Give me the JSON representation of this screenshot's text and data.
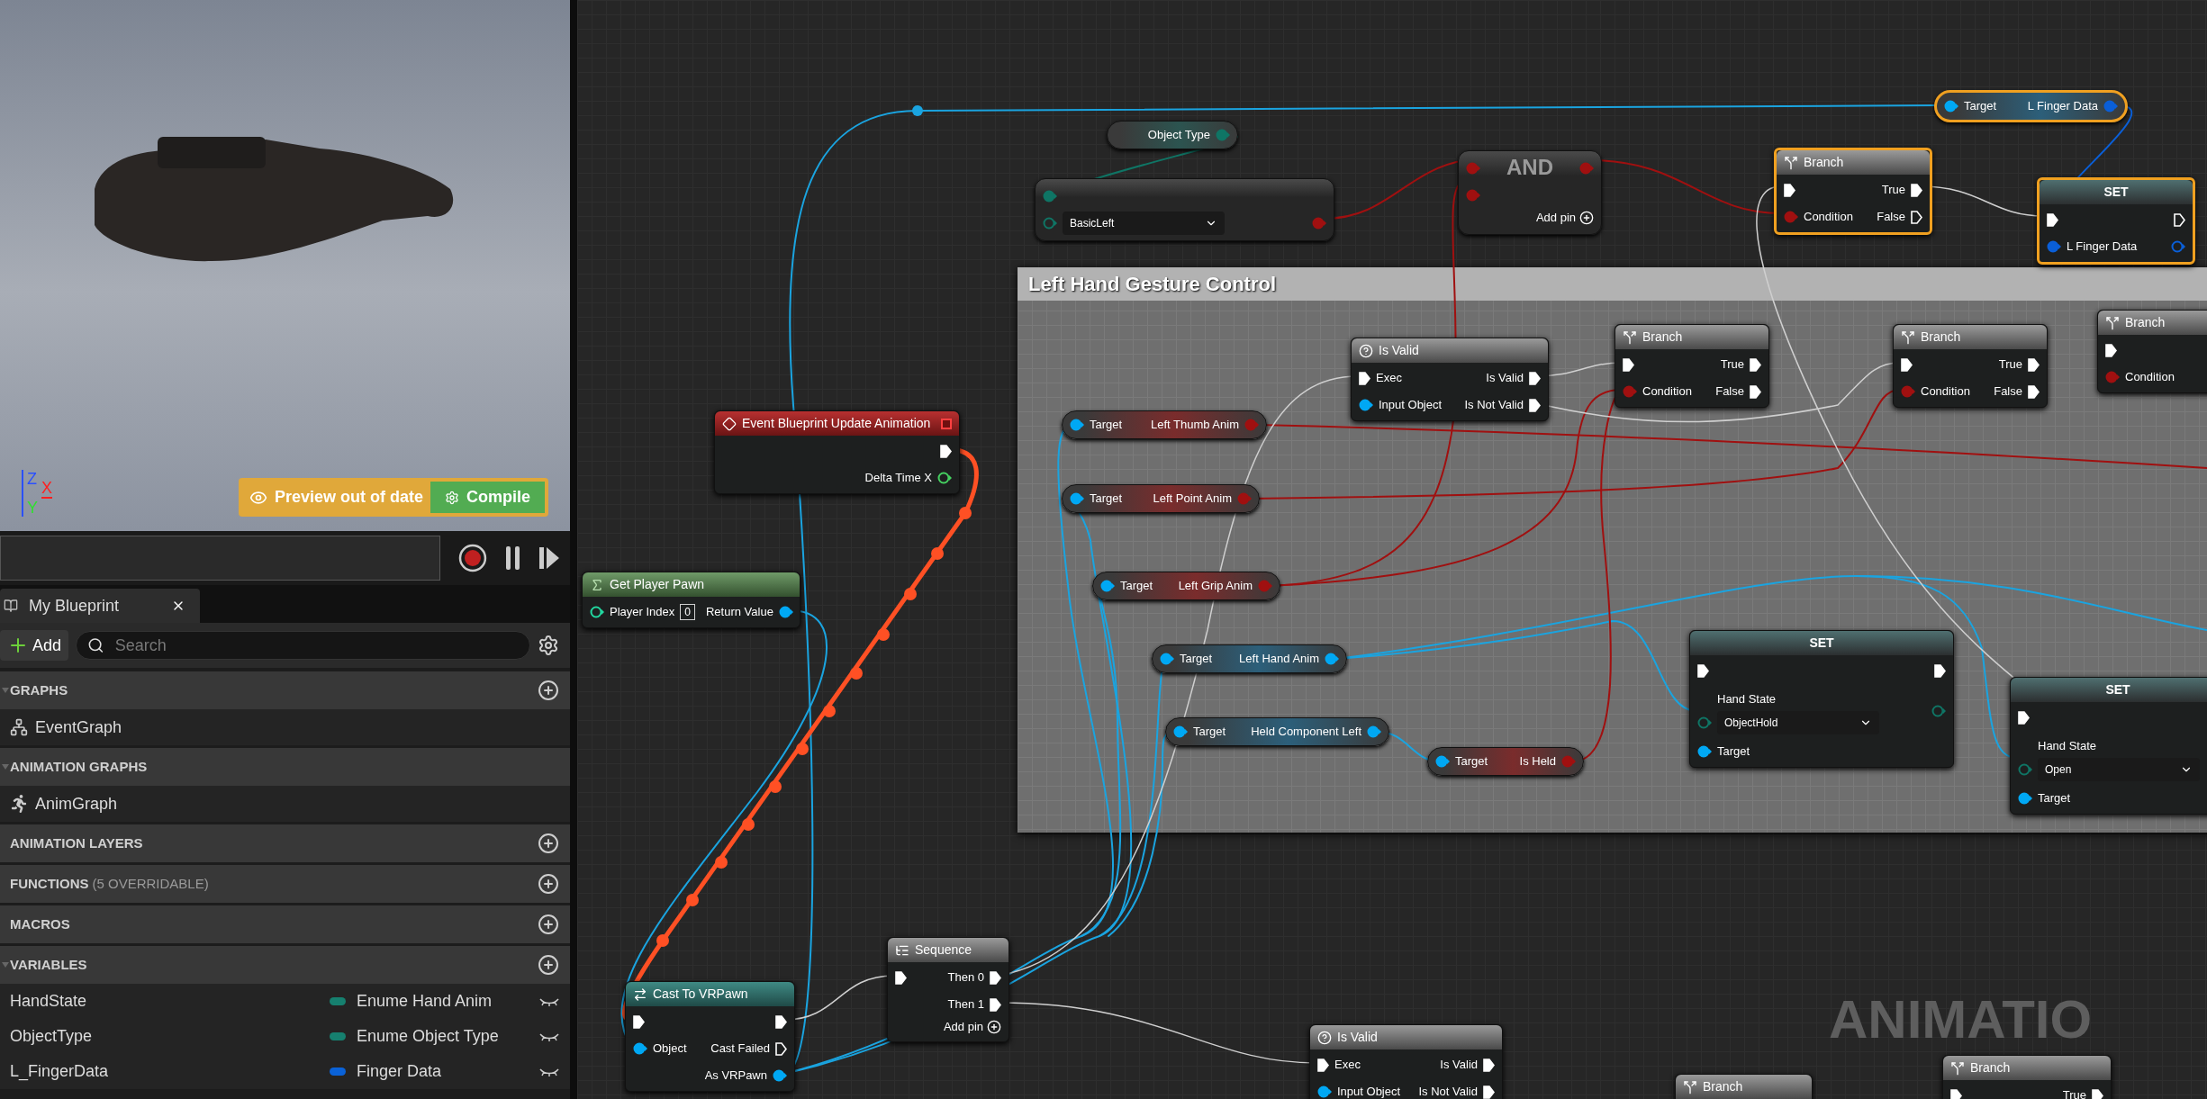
{
  "viewport": {
    "axes": [
      "Z",
      "Y",
      "X"
    ],
    "notice": "Preview out of date",
    "compile_button": "Compile"
  },
  "panel_tab": {
    "title": "My Blueprint"
  },
  "add_button": "Add",
  "search": {
    "placeholder": "Search"
  },
  "sections": [
    {
      "title": "GRAPHS",
      "expanded": true,
      "addable": true,
      "items": [
        {
          "name": "EventGraph",
          "kind": "graph"
        }
      ]
    },
    {
      "title": "ANIMATION GRAPHS",
      "expanded": true,
      "addable": false,
      "items": [
        {
          "name": "AnimGraph",
          "kind": "anim"
        }
      ]
    },
    {
      "title": "ANIMATION LAYERS",
      "expanded": false,
      "addable": true
    },
    {
      "title": "FUNCTIONS",
      "note": "(5 OVERRIDABLE)",
      "expanded": false,
      "addable": true
    },
    {
      "title": "MACROS",
      "expanded": false,
      "addable": true
    },
    {
      "title": "VARIABLES",
      "expanded": true,
      "addable": true,
      "items": [
        {
          "name": "HandState",
          "kind": "variable",
          "type": "Enume Hand Anim",
          "color": "#16806f"
        },
        {
          "name": "ObjectType",
          "kind": "variable",
          "type": "Enume Object Type",
          "color": "#16806f"
        },
        {
          "name": "L_FingerData",
          "kind": "variable",
          "type": "Finger Data",
          "color": "#0a62d8"
        }
      ]
    }
  ],
  "graph": {
    "comment": "Left Hand Gesture Control",
    "corner_label": "ANIMATIO",
    "nodes": [
      {
        "kind": "getter",
        "selected": true,
        "rows": [
          {
            "in": {
              "label": "Target",
              "kind": "object",
              "connected": true
            },
            "out": {
              "label": "L Finger Data",
              "kind": "struct",
              "connected": true
            }
          }
        ]
      },
      {
        "kind": "getter",
        "selected": false,
        "rows": [
          {
            "out": {
              "label": "Object Type",
              "kind": "enum",
              "connected": true
            }
          }
        ]
      },
      {
        "kind": "compact",
        "selected": false,
        "rows": [
          {
            "in": {
              "kind": "enum",
              "connected": true
            }
          },
          {
            "in": {
              "kind": "enum",
              "connected": false,
              "value": "BasicLeft"
            },
            "out": {
              "kind": "bool",
              "connected": true
            }
          }
        ]
      },
      {
        "kind": "compact",
        "title": "AND",
        "selected": false,
        "rows": [
          {
            "in": {
              "kind": "bool",
              "connected": true
            },
            "out": {
              "kind": "bool",
              "connected": true
            }
          },
          {
            "in": {
              "kind": "bool",
              "connected": true
            }
          }
        ],
        "add_pin": "Add pin"
      },
      {
        "kind": "branch",
        "title": "Branch",
        "selected": true,
        "rows": [
          {
            "in": {
              "kind": "exec",
              "connected": true
            },
            "out": {
              "label": "True",
              "kind": "exec",
              "connected": true
            }
          },
          {
            "in": {
              "label": "Condition",
              "kind": "bool",
              "connected": true
            },
            "out": {
              "label": "False",
              "kind": "exec",
              "connected": false
            }
          }
        ]
      },
      {
        "kind": "set",
        "title": "SET",
        "selected": true,
        "rows": [
          {
            "in": {
              "kind": "exec",
              "connected": true
            },
            "out": {
              "kind": "exec",
              "connected": false
            }
          },
          {
            "in": {
              "label": "L Finger Data",
              "kind": "struct",
              "connected": true
            },
            "out": {
              "kind": "struct",
              "connected": false
            }
          }
        ]
      },
      {
        "kind": "event",
        "title": "Event Blueprint Update Animation",
        "selected": false,
        "rows": [
          {
            "out": {
              "kind": "exec",
              "connected": true
            }
          },
          {
            "out": {
              "label": "Delta Time X",
              "kind": "float",
              "connected": false
            }
          }
        ]
      },
      {
        "kind": "function",
        "title": "Get Player Pawn",
        "selected": false,
        "rows": [
          {
            "in": {
              "label": "Player Index",
              "kind": "int",
              "connected": false,
              "value": "0"
            },
            "out": {
              "label": "Return Value",
              "kind": "object",
              "connected": true
            }
          }
        ]
      },
      {
        "kind": "isvalid",
        "title": "Is Valid",
        "selected": false,
        "rows": [
          {
            "in": {
              "label": "Exec",
              "kind": "exec",
              "connected": true
            },
            "out": {
              "label": "Is Valid",
              "kind": "exec",
              "connected": true
            }
          },
          {
            "in": {
              "label": "Input Object",
              "kind": "object",
              "connected": true
            },
            "out": {
              "label": "Is Not Valid",
              "kind": "exec",
              "connected": true
            }
          }
        ]
      },
      {
        "kind": "branch",
        "title": "Branch",
        "selected": false,
        "rows": [
          {
            "in": {
              "kind": "exec",
              "connected": true
            },
            "out": {
              "label": "True",
              "kind": "exec",
              "connected": true
            }
          },
          {
            "in": {
              "label": "Condition",
              "kind": "bool",
              "connected": true
            },
            "out": {
              "label": "False",
              "kind": "exec",
              "connected": true
            }
          }
        ]
      },
      {
        "kind": "branch",
        "title": "Branch",
        "selected": false,
        "rows": [
          {
            "in": {
              "kind": "exec",
              "connected": true
            },
            "out": {
              "label": "True",
              "kind": "exec",
              "connected": true
            }
          },
          {
            "in": {
              "label": "Condition",
              "kind": "bool",
              "connected": true
            },
            "out": {
              "label": "False",
              "kind": "exec",
              "connected": true
            }
          }
        ]
      },
      {
        "kind": "branch",
        "title": "Branch",
        "selected": false,
        "rows": [
          {
            "in": {
              "kind": "exec",
              "connected": true
            }
          },
          {
            "in": {
              "label": "Condition",
              "kind": "bool",
              "connected": true
            }
          }
        ]
      },
      {
        "kind": "getter",
        "selected": false,
        "rows": [
          {
            "in": {
              "label": "Target",
              "kind": "object",
              "connected": true
            },
            "out": {
              "label": "Left Thumb Anim",
              "kind": "bool",
              "connected": true
            }
          }
        ]
      },
      {
        "kind": "getter",
        "selected": false,
        "rows": [
          {
            "in": {
              "label": "Target",
              "kind": "object",
              "connected": true
            },
            "out": {
              "label": "Left Point Anim",
              "kind": "bool",
              "connected": true
            }
          }
        ]
      },
      {
        "kind": "getter",
        "selected": false,
        "rows": [
          {
            "in": {
              "label": "Target",
              "kind": "object",
              "connected": true
            },
            "out": {
              "label": "Left Grip Anim",
              "kind": "bool",
              "connected": true
            }
          }
        ]
      },
      {
        "kind": "getter",
        "selected": false,
        "rows": [
          {
            "in": {
              "label": "Target",
              "kind": "object",
              "connected": true
            },
            "out": {
              "label": "Left Hand Anim",
              "kind": "object",
              "connected": true
            }
          }
        ]
      },
      {
        "kind": "getter",
        "selected": false,
        "rows": [
          {
            "in": {
              "label": "Target",
              "kind": "object",
              "connected": true
            },
            "out": {
              "label": "Held Component Left",
              "kind": "object",
              "connected": true
            }
          }
        ]
      },
      {
        "kind": "getter",
        "selected": false,
        "rows": [
          {
            "in": {
              "label": "Target",
              "kind": "object",
              "connected": true
            },
            "out": {
              "label": "Is Held",
              "kind": "bool",
              "connected": true
            }
          }
        ]
      },
      {
        "kind": "set",
        "title": "SET",
        "selected": false,
        "rows": [
          {
            "in": {
              "kind": "exec",
              "connected": true
            },
            "out": {
              "kind": "exec",
              "connected": true
            }
          },
          {
            "in": {
              "label": "Hand State",
              "kind": "enum",
              "connected": false,
              "value": "ObjectHold"
            },
            "out": {
              "kind": "enum",
              "connected": false
            }
          },
          {
            "in": {
              "label": "Target",
              "kind": "object",
              "connected": true
            }
          }
        ]
      },
      {
        "kind": "set",
        "title": "SET",
        "selected": false,
        "rows": [
          {
            "in": {
              "kind": "exec",
              "connected": true
            }
          },
          {
            "in": {
              "label": "Hand State",
              "kind": "enum",
              "connected": false,
              "value": "Open"
            }
          },
          {
            "in": {
              "label": "Target",
              "kind": "object",
              "connected": true
            }
          }
        ]
      },
      {
        "kind": "cast",
        "title": "Cast To VRPawn",
        "selected": false,
        "rows": [
          {
            "in": {
              "kind": "exec",
              "connected": true
            },
            "out": {
              "kind": "exec",
              "connected": true
            }
          },
          {
            "in": {
              "label": "Object",
              "kind": "object",
              "connected": true
            },
            "out": {
              "label": "Cast Failed",
              "kind": "exec",
              "connected": false
            }
          },
          {
            "out": {
              "label": "As VRPawn",
              "kind": "object",
              "connected": true
            }
          }
        ]
      },
      {
        "kind": "sequence",
        "title": "Sequence",
        "selected": false,
        "rows": [
          {
            "in": {
              "kind": "exec",
              "connected": true
            },
            "out": {
              "label": "Then 0",
              "kind": "exec",
              "connected": true
            }
          },
          {
            "out": {
              "label": "Then 1",
              "kind": "exec",
              "connected": true
            }
          }
        ],
        "add_pin": "Add pin"
      },
      {
        "kind": "isvalid",
        "title": "Is Valid",
        "selected": false,
        "rows": [
          {
            "in": {
              "label": "Exec",
              "kind": "exec",
              "connected": true
            },
            "out": {
              "label": "Is Valid",
              "kind": "exec",
              "connected": true
            }
          },
          {
            "in": {
              "label": "Input Object",
              "kind": "object",
              "connected": true
            },
            "out": {
              "label": "Is Not Valid",
              "kind": "exec",
              "connected": true
            }
          }
        ]
      },
      {
        "kind": "branch",
        "title": "Branch",
        "selected": false
      },
      {
        "kind": "branch",
        "title": "Branch",
        "selected": false,
        "rows": [
          {
            "in": {
              "kind": "exec",
              "connected": true
            },
            "out": {
              "label": "True",
              "kind": "exec",
              "connected": true
            }
          }
        ]
      }
    ]
  }
}
